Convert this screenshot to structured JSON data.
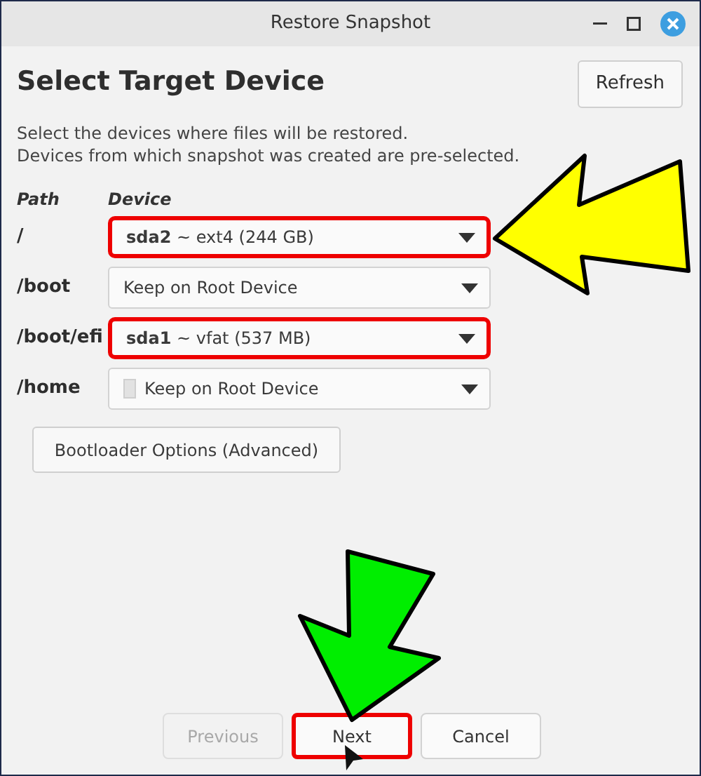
{
  "window": {
    "title": "Restore Snapshot"
  },
  "heading": "Select Target Device",
  "refresh_button": "Refresh",
  "description": [
    "Select the devices where files will be restored.",
    "Devices from which snapshot was created are pre-selected."
  ],
  "columns": [
    "Path",
    "Device"
  ],
  "rows": [
    {
      "path": "/",
      "device": "**sda2** ~ ext4 (244 GB)",
      "highlighted": true,
      "has_icon": false
    },
    {
      "path": "/boot",
      "device": "Keep on Root Device",
      "highlighted": false,
      "has_icon": false
    },
    {
      "path": "/boot/efi",
      "device": "**sda1** ~ vfat (537 MB)",
      "highlighted": true,
      "has_icon": false
    },
    {
      "path": "/home",
      "device": "Keep on Root Device",
      "highlighted": false,
      "has_icon": true
    }
  ],
  "bootloader_button": "Bootloader Options (Advanced)",
  "buttons": [
    {
      "label": "Previous",
      "disabled": true,
      "highlighted": false
    },
    {
      "label": "Next",
      "disabled": false,
      "highlighted": true
    },
    {
      "label": "Cancel",
      "disabled": false,
      "highlighted": false
    }
  ]
}
